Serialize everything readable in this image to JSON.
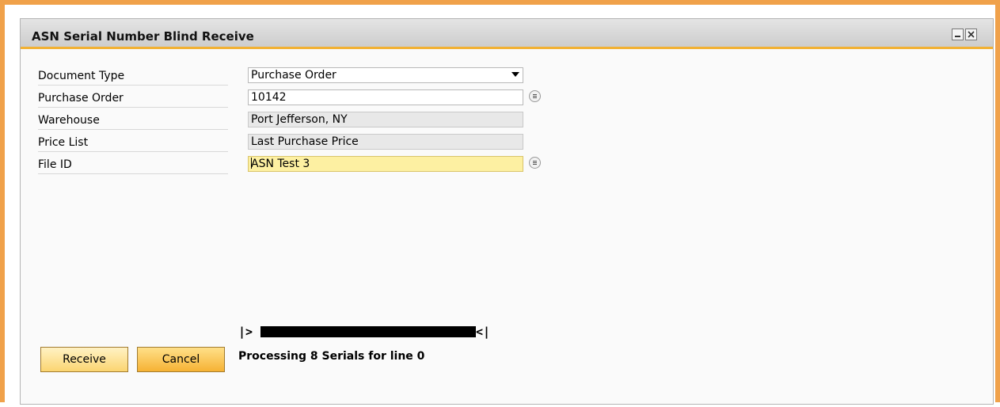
{
  "window": {
    "title": "ASN Serial Number Blind Receive"
  },
  "form": {
    "document_type": {
      "label": "Document Type",
      "value": "Purchase Order"
    },
    "purchase_order": {
      "label": "Purchase Order",
      "value": "10142"
    },
    "warehouse": {
      "label": "Warehouse",
      "value": "Port Jefferson, NY"
    },
    "price_list": {
      "label": "Price List",
      "value": "Last Purchase Price"
    },
    "file_id": {
      "label": "File ID",
      "value": "ASN Test 3"
    }
  },
  "barcode": {
    "start": "|>",
    "end": "<|"
  },
  "status": "Processing 8 Serials for line 0",
  "buttons": {
    "receive": "Receive",
    "cancel": "Cancel"
  },
  "icons": {
    "minimize": "minimize-icon",
    "close": "close-icon",
    "choose_from_list": "choose-from-list-icon",
    "dropdown": "dropdown-arrow-icon"
  },
  "colors": {
    "frame_border": "#f0a14a",
    "title_underline": "#f2b133",
    "focused_field": "#fdf0a2",
    "readonly_field": "#e8e8e8"
  }
}
